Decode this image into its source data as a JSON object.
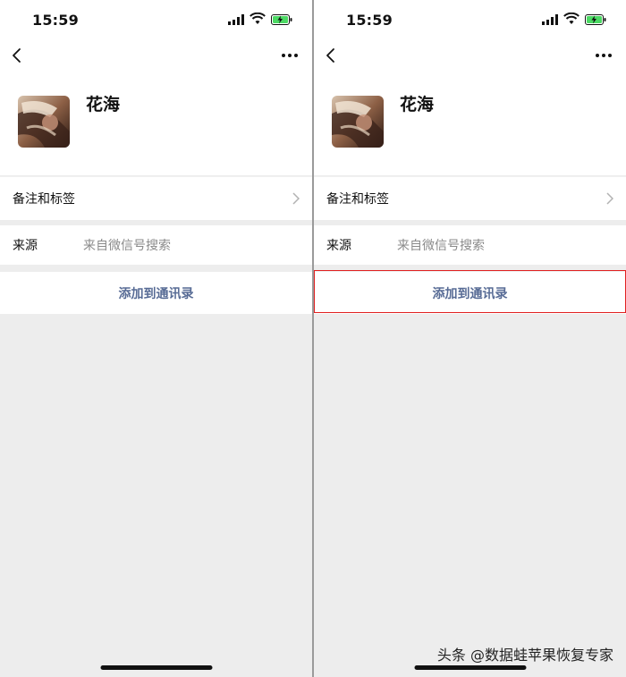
{
  "screens": [
    {
      "status": {
        "time": "15:59"
      },
      "profile": {
        "name": "花海"
      },
      "rows": {
        "remarks_label": "备注和标签",
        "source_label": "来源",
        "source_value": "来自微信号搜索",
        "add_button": "添加到通讯录"
      },
      "highlight_add": false
    },
    {
      "status": {
        "time": "15:59"
      },
      "profile": {
        "name": "花海"
      },
      "rows": {
        "remarks_label": "备注和标签",
        "source_label": "来源",
        "source_value": "来自微信号搜索",
        "add_button": "添加到通讯录"
      },
      "highlight_add": true
    }
  ],
  "watermark": "头条 @数据蛙苹果恢复专家",
  "colors": {
    "accent_link": "#576b95",
    "highlight_border": "#e02020",
    "background": "#ededed"
  }
}
